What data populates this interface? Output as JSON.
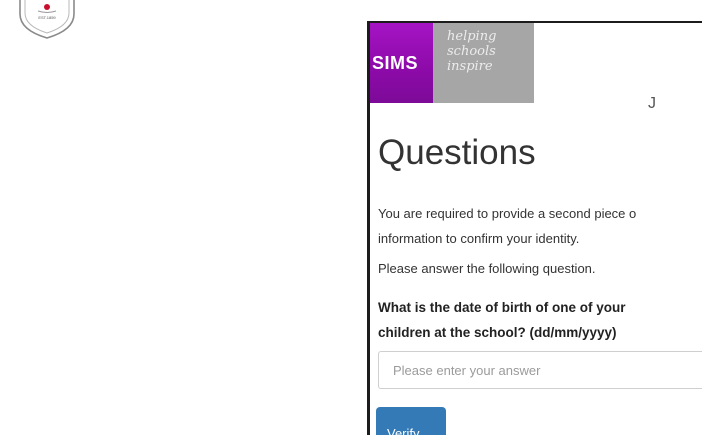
{
  "crest": {
    "text": "EST.1859",
    "icon": "school-crest-icon"
  },
  "brand": {
    "logo": "SIMS",
    "tagline": "helping\nschools\ninspire",
    "colors": {
      "logo_bg": "#8c0aa8",
      "tagline_bg": "#a6a6a6"
    }
  },
  "main": {
    "heading": "Questions",
    "intro": "You are required to provide a second piece o information to confirm your identity.",
    "prompt": "Please answer the following question.",
    "question": "What is the date of birth of one of your children at the school? (dd/mm/yyyy)",
    "answer": {
      "value": "",
      "placeholder": "Please enter your answer"
    },
    "verify_label": "Verify",
    "accent": "#337ab7"
  }
}
